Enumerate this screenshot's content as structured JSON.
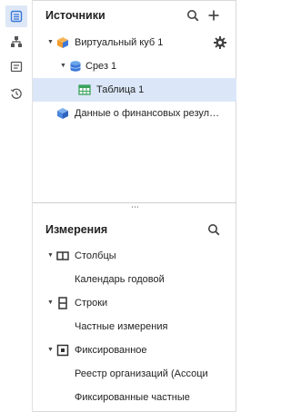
{
  "rail": {
    "items": [
      {
        "icon": "sources-list-icon",
        "active": true
      },
      {
        "icon": "hierarchy-icon",
        "active": false
      },
      {
        "icon": "comment-icon",
        "active": false
      },
      {
        "icon": "history-icon",
        "active": false
      }
    ]
  },
  "sources": {
    "title": "Источники",
    "search_icon": "search-icon",
    "add_icon": "plus-icon",
    "tree": [
      {
        "label": "Виртуальный куб 1",
        "icon": "cube-icon",
        "level": 0,
        "expanded": true
      },
      {
        "label": "Срез 1",
        "icon": "slice-icon",
        "level": 1,
        "expanded": true
      },
      {
        "label": "Таблица 1",
        "icon": "table-icon",
        "level": 2,
        "selected": true
      },
      {
        "label": "Данные о финансовых резул…",
        "icon": "cube-blue-icon",
        "level": 0
      }
    ]
  },
  "dimensions": {
    "title": "Измерения",
    "search_icon": "search-icon",
    "groups": [
      {
        "label": "Столбцы",
        "icon": "columns-icon",
        "items": [
          "Календарь годовой"
        ]
      },
      {
        "label": "Строки",
        "icon": "rows-icon",
        "items": [
          "Частные измерения"
        ]
      },
      {
        "label": "Фиксированное",
        "icon": "fixed-icon",
        "items": [
          "Реестр организаций (Ассоци",
          "Фиксированные частные"
        ]
      }
    ]
  },
  "splitter": {
    "handle": "⋯"
  },
  "colors": {
    "selected_bg": "#dbe7f8",
    "rail_active_bg": "#dde7f6",
    "accent_blue": "#3b78d8",
    "cube_orange": "#f29b2e",
    "table_green": "#3aa15d"
  }
}
